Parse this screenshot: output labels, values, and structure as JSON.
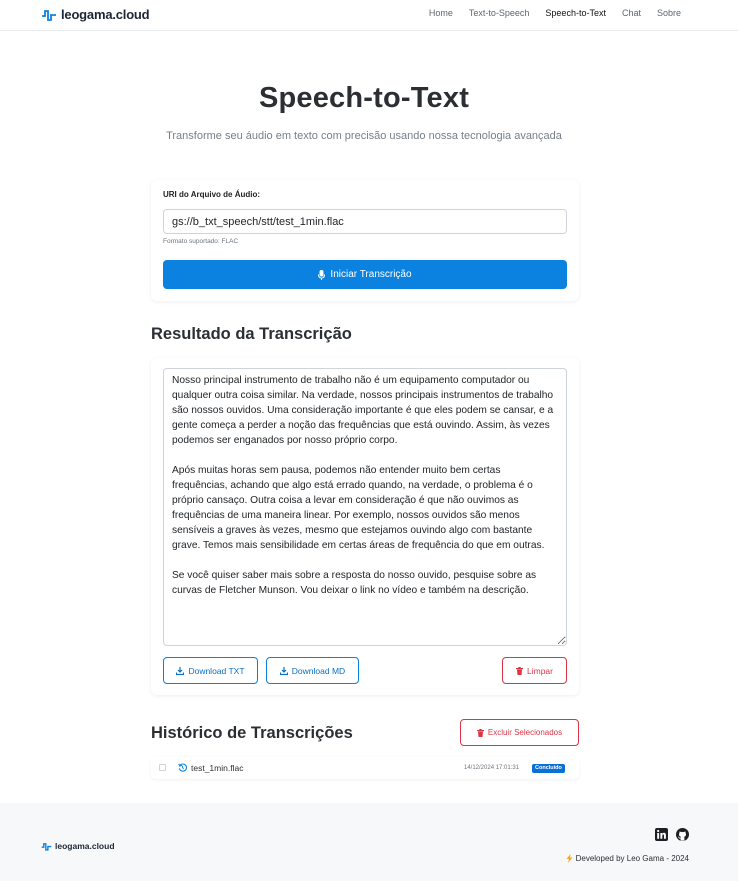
{
  "nav": {
    "brand": "leogama.cloud",
    "links": [
      "Home",
      "Text-to-Speech",
      "Speech-to-Text",
      "Chat",
      "Sobre"
    ],
    "active": "Speech-to-Text"
  },
  "hero": {
    "title": "Speech-to-Text",
    "subtitle": "Transforme seu áudio em texto com precisão usando nossa tecnologia avançada"
  },
  "upload": {
    "label": "URI do Arquivo de Áudio:",
    "value": "gs://b_txt_speech/stt/test_1min.flac",
    "help": "Formato suportado: FLAC",
    "button": "Iniciar Transcrição"
  },
  "result": {
    "title": "Resultado da Transcrição",
    "paragraphs": [
      "Nosso principal instrumento de trabalho não é um equipamento computador ou qualquer outra coisa similar. Na verdade, nossos principais instrumentos de trabalho são nossos ouvidos. Uma consideração importante é que eles podem se cansar, e a gente começa a perder a noção das frequências que está ouvindo. Assim, às vezes podemos ser enganados por nosso próprio corpo.",
      "Após muitas horas sem pausa, podemos não entender muito bem certas frequências, achando que algo está errado quando, na verdade, o problema é o próprio cansaço. Outra coisa a levar em consideração é que não ouvimos as frequências de uma maneira linear. Por exemplo, nossos ouvidos são menos sensíveis a graves às vezes, mesmo que estejamos ouvindo algo com bastante grave. Temos mais sensibilidade em certas áreas de frequência do que em outras.",
      "Se você quiser saber mais sobre a resposta do nosso ouvido, pesquise sobre as curvas de Fletcher Munson. Vou deixar o link no vídeo e também na descrição."
    ],
    "download_txt": "Download TXT",
    "download_md": "Download MD",
    "clear": "Limpar"
  },
  "history": {
    "title": "Histórico de Transcrições",
    "delete_selected": "Excluir Selecionados",
    "items": [
      {
        "name": "test_1min.flac",
        "date": "14/12/2024 17:01:31",
        "status": "Concluído"
      }
    ]
  },
  "footer": {
    "brand": "leogama.cloud",
    "developed": "Developed by Leo Gama - 2024",
    "icons": [
      "linkedin-icon",
      "github-icon"
    ]
  },
  "colors": {
    "primary": "#0b82e0",
    "danger": "#dc3545",
    "badge": "#0b6fd8"
  }
}
